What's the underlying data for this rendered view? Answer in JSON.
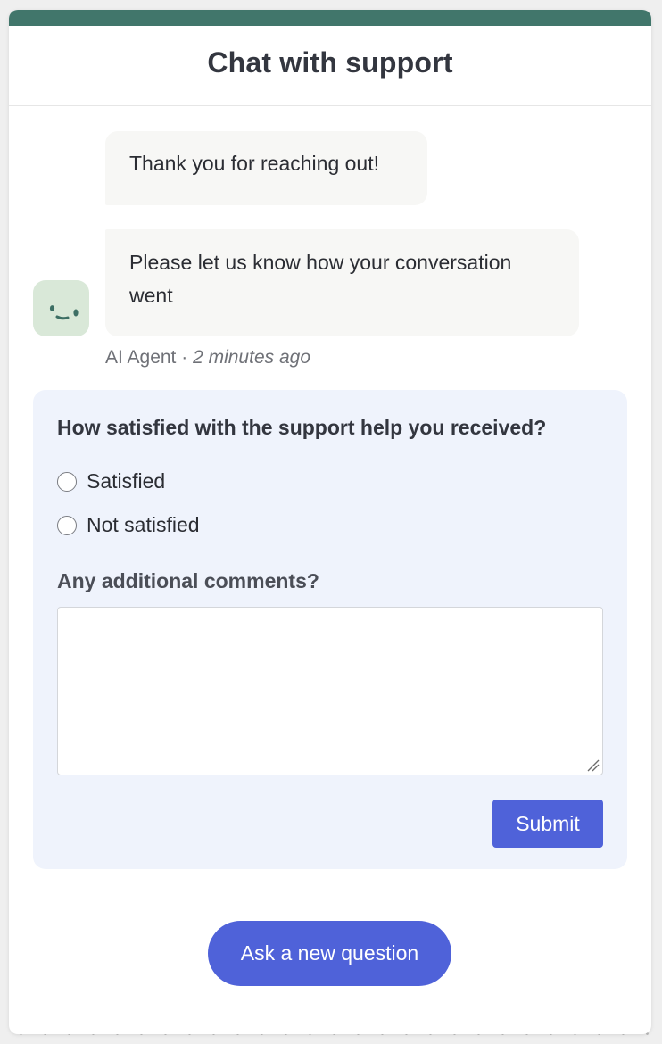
{
  "header": {
    "title": "Chat with support"
  },
  "messages": [
    {
      "text": "Thank you for reaching out!"
    },
    {
      "text": "Please let us know how your conversation went"
    }
  ],
  "meta": {
    "sender": "AI Agent",
    "separator": " · ",
    "time": "2 minutes ago"
  },
  "avatar": {
    "icon": "smile-face-icon"
  },
  "survey": {
    "question": "How satisfied with the support help you received?",
    "options": [
      {
        "label": "Satisfied",
        "selected": false
      },
      {
        "label": "Not satisfied",
        "selected": false
      }
    ],
    "comments_label": "Any additional comments?",
    "comments_value": "",
    "submit_label": "Submit"
  },
  "footer": {
    "ask_label": "Ask a new question"
  },
  "colors": {
    "topbar": "#41766b",
    "accent": "#4f62d9",
    "survey_bg": "#eff3fc",
    "bubble_bg": "#f7f7f5",
    "avatar_bg": "#d9e8d8"
  }
}
